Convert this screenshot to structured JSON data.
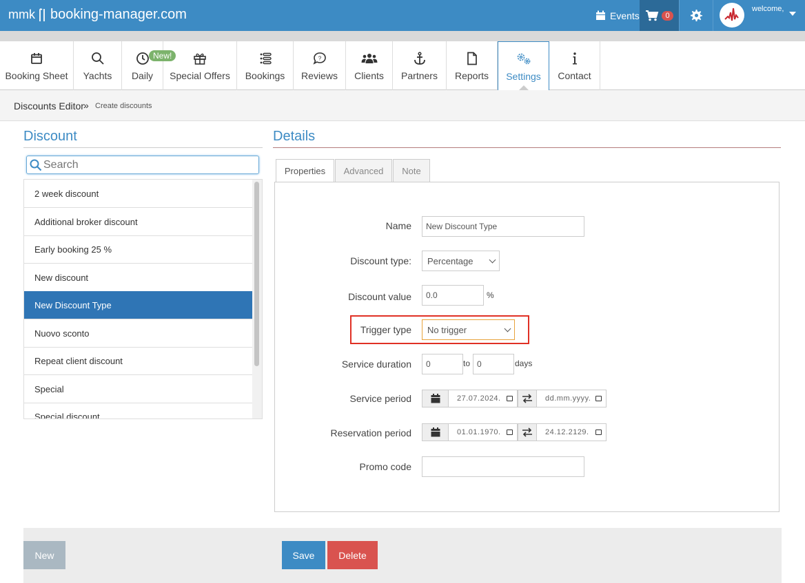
{
  "header": {
    "logo_prefix": "mmk",
    "logo_text": "booking-manager.com",
    "events_label": "Events",
    "cart_count": "0",
    "welcome_text": "welcome,"
  },
  "nav": {
    "items": [
      {
        "label": "Booking Sheet",
        "icon": "calendar-icon"
      },
      {
        "label": "Yachts",
        "icon": "search-icon"
      },
      {
        "label": "Daily",
        "icon": "clock-icon"
      },
      {
        "label": "Special Offers",
        "icon": "gift-icon"
      },
      {
        "label": "Bookings",
        "icon": "list-icon"
      },
      {
        "label": "Reviews",
        "icon": "chat-icon"
      },
      {
        "label": "Clients",
        "icon": "users-icon"
      },
      {
        "label": "Partners",
        "icon": "anchor-icon"
      },
      {
        "label": "Reports",
        "icon": "file-icon"
      },
      {
        "label": "Settings",
        "icon": "gears-icon"
      },
      {
        "label": "Contact",
        "icon": "info-icon"
      }
    ],
    "new_badge": "New!"
  },
  "breadcrumb": {
    "first": "Discounts Editor",
    "separator": "»",
    "second": "Create discounts"
  },
  "left": {
    "title": "Discount",
    "search_placeholder": "Search",
    "items": [
      "2 week discount",
      "Additional broker discount",
      "Early booking 25 %",
      "New discount",
      "New Discount Type",
      "Nuovo sconto",
      "Repeat client discount",
      "Special",
      "Special discount"
    ],
    "selected_index": 4
  },
  "details": {
    "title": "Details",
    "tabs": [
      "Properties",
      "Advanced",
      "Note"
    ],
    "active_tab": "Properties",
    "form": {
      "name_label": "Name",
      "name_value": "New Discount Type",
      "discount_type_label": "Discount type:",
      "discount_type_value": "Percentage",
      "discount_value_label": "Discount value",
      "discount_value_value": "0.0",
      "discount_value_unit": "%",
      "trigger_type_label": "Trigger type",
      "trigger_type_value": "No trigger",
      "service_duration_label": "Service duration",
      "service_duration_from": "0",
      "service_duration_to_label": "to",
      "service_duration_to": "0",
      "service_duration_unit": "days",
      "service_period_label": "Service period",
      "service_period_from": "27.07.2024.",
      "service_period_to": "dd.mm.yyyy.",
      "reservation_period_label": "Reservation period",
      "reservation_period_from": "01.01.1970.",
      "reservation_period_to": "24.12.2129.",
      "promo_code_label": "Promo code",
      "promo_code_value": ""
    }
  },
  "footer": {
    "new_label": "New",
    "save_label": "Save",
    "delete_label": "Delete"
  },
  "colors": {
    "brand": "#3d8bc4",
    "selected": "#2f75b5",
    "save": "#3d8bc4",
    "delete": "#d9534f",
    "highlight": "#e03024"
  }
}
